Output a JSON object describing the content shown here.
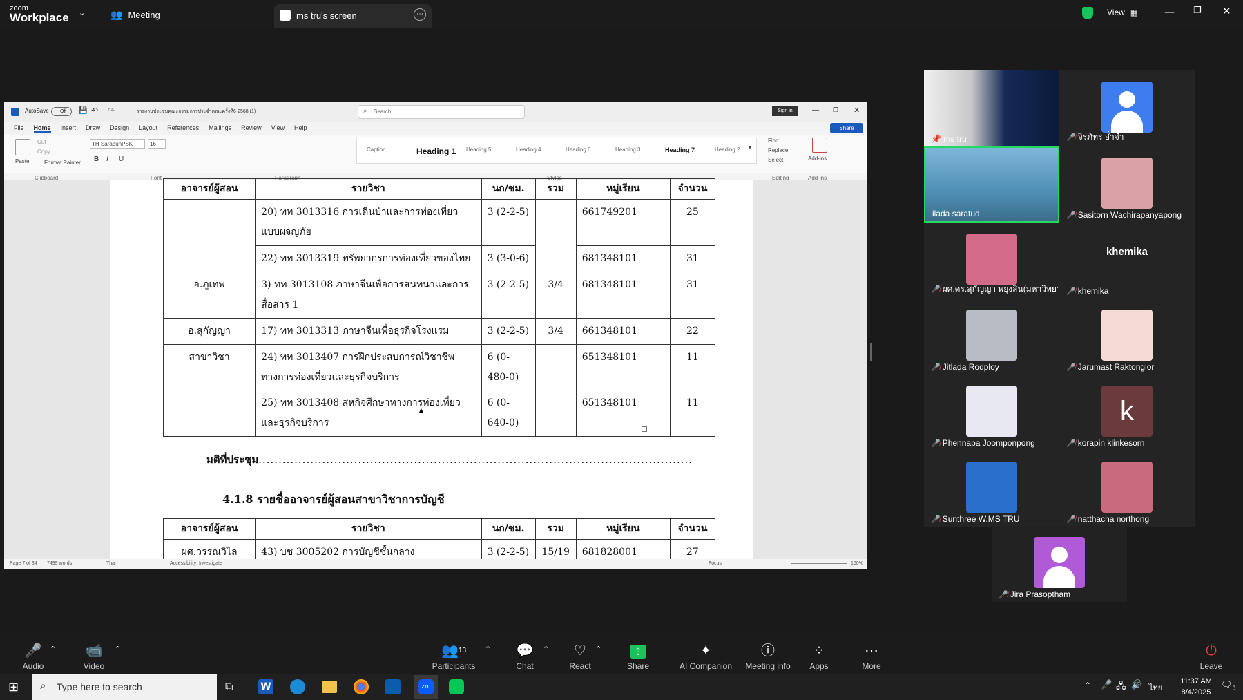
{
  "app": {
    "brand_top": "zoom",
    "brand_bottom": "Workplace",
    "meeting_label": "Meeting",
    "share_tab_label": "ms tru's screen",
    "view_label": "View"
  },
  "word": {
    "autosave": "AutoSave",
    "autosave_state": "Off",
    "doc_title": "รายงานประชุมคณะกรรมการประจำคณะครั้งที่6-2568 (1)",
    "search_placeholder": "Search",
    "signin": "Sign in",
    "share": "Share",
    "menu": [
      "File",
      "Home",
      "Insert",
      "Draw",
      "Design",
      "Layout",
      "References",
      "Mailings",
      "Review",
      "View",
      "Help"
    ],
    "font_name": "TH SarabunPSK",
    "font_size": "16",
    "clipboard": {
      "paste": "Paste",
      "cut": "Cut",
      "copy": "Copy",
      "format_painter": "Format Painter",
      "group": "Clipboard"
    },
    "groups": {
      "font": "Font",
      "paragraph": "Paragraph",
      "styles": "Styles",
      "editing": "Editing",
      "addins": "Add-ins"
    },
    "styles": [
      "Caption",
      "Heading 1",
      "Heading 5",
      "Heading 4",
      "Heading 6",
      "Heading 3",
      "Heading 7",
      "Heading 2"
    ],
    "editing": {
      "find": "Find",
      "replace": "Replace",
      "select": "Select"
    },
    "addins_label": "Add-ins",
    "status": {
      "page": "Page 7 of 34",
      "words": "7499 words",
      "lang": "Thai",
      "accessibility": "Accessibility: Investigate",
      "focus": "Focus",
      "zoom": "160%"
    }
  },
  "doc": {
    "table1": {
      "headers": [
        "อาจารย์ผู้สอน",
        "รายวิชา",
        "นก/ชม.",
        "รวม",
        "หมู่เรียน",
        "จำนวน"
      ],
      "rows": [
        {
          "teacher": "",
          "course": "20) ทท 3013316 การเดินป่าและการท่องเที่ยวแบบผจญภัย",
          "credit": "3 (2-2-5)",
          "total": "",
          "section": "661749201",
          "count": "25"
        },
        {
          "teacher": "",
          "course": "22) ทท 3013319 ทรัพยากรการท่องเที่ยวของไทย",
          "credit": "3 (3-0-6)",
          "total": "",
          "section": "681348101",
          "count": "31"
        },
        {
          "teacher": "อ.ภูเทพ",
          "course": "3) ทท 3013108 ภาษาจีนเพื่อการสนทนาและการสื่อสาร 1",
          "credit": "3 (2-2-5)",
          "total": "3/4",
          "section": "681348101",
          "count": "31"
        },
        {
          "teacher": "อ.สุกัญญา",
          "course": "17) ทท 3013313 ภาษาจีนเพื่อธุรกิจโรงแรม",
          "credit": "3 (2-2-5)",
          "total": "3/4",
          "section": "661348101",
          "count": "22"
        },
        {
          "teacher": "สาขาวิชา",
          "course": "24) ทท 3013407 การฝึกประสบการณ์วิชาชีพทางการท่องเที่ยวและธุรกิจบริการ",
          "credit": "6 (0-480-0)",
          "total": "",
          "section": "651348101",
          "count": "11"
        },
        {
          "teacher": "",
          "course": "25) ทท 3013408 สหกิจศึกษาทางการท่องเที่ยวและธุรกิจบริการ",
          "credit": "6 (0-640-0)",
          "total": "",
          "section": "651348101",
          "count": "11"
        }
      ]
    },
    "resolution_label": "มติที่ประชุม",
    "section_heading": "4.1.8 รายชื่ออาจารย์ผู้สอนสาขาวิชาการบัญชี",
    "table2": {
      "headers": [
        "อาจารย์ผู้สอน",
        "รายวิชา",
        "นก/ชม.",
        "รวม",
        "หมู่เรียน",
        "จำนวน"
      ],
      "rows": [
        {
          "teacher": "ผศ.วรรณวิไล",
          "course": "43) บช 3005202 การบัญชีชั้นกลาง",
          "credit": "3 (2-2-5)",
          "total": "15/19",
          "section": "681828001",
          "count": "27"
        }
      ]
    }
  },
  "participants": [
    {
      "name": "ms tru",
      "pinned": true
    },
    {
      "name": "จิรภัทร อ่ำจ๋า"
    },
    {
      "name": "ilada saratud",
      "active": true
    },
    {
      "name": "Sasitorn Wachirapanyapong"
    },
    {
      "name": "ผศ.ดร.สุกัญญา พยุงสิน(มหาวิทยา..."
    },
    {
      "name": "khemika",
      "big_text": "khemika"
    },
    {
      "name": "Jitlada Rodploy"
    },
    {
      "name": "Jarumast Raktonglor"
    },
    {
      "name": "Phennapa Joomponpong"
    },
    {
      "name": "korapin klinkesorn",
      "initial": "k"
    },
    {
      "name": "Sunthree W.MS TRU"
    },
    {
      "name": "natthacha northong"
    },
    {
      "name": "Jira Prasoptham"
    }
  ],
  "toolbar": {
    "audio": "Audio",
    "video": "Video",
    "participants": "Participants",
    "participants_count": "13",
    "chat": "Chat",
    "react": "React",
    "share": "Share",
    "ai": "AI Companion",
    "info": "Meeting info",
    "apps": "Apps",
    "more": "More",
    "leave": "Leave"
  },
  "taskbar": {
    "search_placeholder": "Type here to search",
    "time": "11:37 AM",
    "date": "8/4/2025",
    "lang": "ไทย",
    "notif_count": "3"
  },
  "colors": {
    "zoom_bg": "#1a1a1a",
    "active_border": "#23d962",
    "share_green": "#19c25a",
    "mute_red": "#e0443e",
    "word_blue": "#185abd"
  }
}
